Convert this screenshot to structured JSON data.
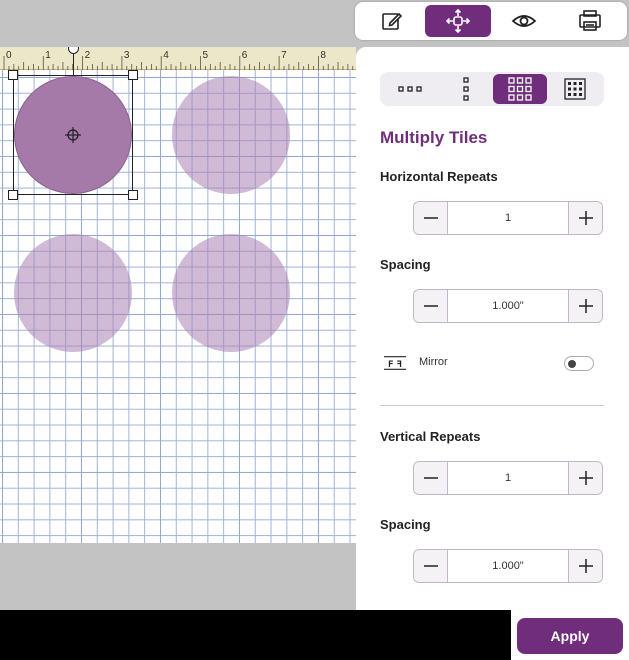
{
  "toolbar": {
    "items": [
      {
        "name": "edit",
        "icon": "pencil-icon"
      },
      {
        "name": "arrange",
        "icon": "move-arrows-icon",
        "active": true
      },
      {
        "name": "preview",
        "icon": "eye-icon"
      },
      {
        "name": "save",
        "icon": "save-icon"
      }
    ]
  },
  "ruler": {
    "labels": [
      "0",
      "1",
      "2",
      "3",
      "4",
      "5",
      "6",
      "7",
      "8"
    ]
  },
  "panel": {
    "layout_options": [
      {
        "icon": "horizontal-dots-icon"
      },
      {
        "icon": "vertical-dots-icon"
      },
      {
        "icon": "grid-3x3-icon",
        "active": true
      },
      {
        "icon": "grid-4x4-icon"
      }
    ],
    "title": "Multiply Tiles",
    "horizontal": {
      "label": "Horizontal Repeats",
      "value": "1",
      "spacing_label": "Spacing",
      "spacing_value": "1.000\""
    },
    "mirror": {
      "label": "Mirror",
      "icon": "mirror-icon",
      "on": false
    },
    "vertical": {
      "label": "Vertical Repeats",
      "value": "1",
      "spacing_label": "Spacing",
      "spacing_value": "1.000\""
    }
  },
  "apply_label": "Apply",
  "colors": {
    "accent": "#6f2d7b",
    "tile": "#a57aa8",
    "tile_faded": "#d8c3db"
  }
}
